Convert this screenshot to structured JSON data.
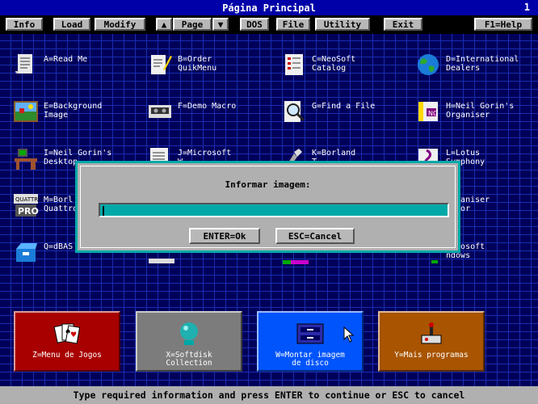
{
  "title": "Página Principal",
  "page_number": "1",
  "menu": {
    "info": "Info",
    "load": "Load",
    "modify": "Modify",
    "page": "Page",
    "dos": "DOS",
    "file": "File",
    "utility": "Utility",
    "exit": "Exit",
    "help": "F1=Help"
  },
  "items": [
    {
      "label": "A=Read Me",
      "icon": "document-icon"
    },
    {
      "label": "B=Order\nQuikMenu",
      "icon": "order-form-icon"
    },
    {
      "label": "C=NeoSoft\nCatalog",
      "icon": "catalog-icon"
    },
    {
      "label": "D=International\nDealers",
      "icon": "globe-icon"
    },
    {
      "label": "E=Background\nImage",
      "icon": "landscape-picture-icon"
    },
    {
      "label": "F=Demo Macro",
      "icon": "cassette-icon"
    },
    {
      "label": "G=Find a File",
      "icon": "magnifier-icon"
    },
    {
      "label": "H=Neil Gorin's\nOrganiser",
      "icon": "organiser-icon"
    },
    {
      "label": "I=Neil Gorin's\nDesktop",
      "icon": "desk-icon"
    },
    {
      "label": "J=Microsoft\nW",
      "icon": "word-icon"
    },
    {
      "label": "K=Borland\nT",
      "icon": "borland-tools-icon"
    },
    {
      "label": "L=Lotus\nSymphony",
      "icon": "lotus-symphony-icon"
    },
    {
      "label": "M=Borl\nQuattro",
      "icon": "quattro-pro-icon"
    },
    {
      "label": "",
      "icon": "blank-icon"
    },
    {
      "label": "",
      "icon": "blank-icon"
    },
    {
      "label": "Organiser\nlator",
      "icon": "organiser-calc-icon"
    },
    {
      "label": "Q=dBAS",
      "icon": "dbase-box-icon"
    },
    {
      "label": "",
      "icon": "blank-icon"
    },
    {
      "label": "",
      "icon": "blank-icon"
    },
    {
      "label": "icrosoft\nndows",
      "icon": "windows-icon"
    }
  ],
  "dialog": {
    "title": "Informar imagem:",
    "input_value": "",
    "ok": "ENTER=Ok",
    "cancel": "ESC=Cancel"
  },
  "big_buttons": [
    {
      "label": "Z=Menu de Jogos",
      "icon": "playing-cards-icon",
      "color": "#a80000"
    },
    {
      "label": "X=Softdisk\nCollection",
      "icon": "crystal-ball-icon",
      "color": "#7c7c7c"
    },
    {
      "label": "W=Montar imagem\nde disco",
      "icon": "disk-drive-icon",
      "color": "#0054fc"
    },
    {
      "label": "Y=Mais programas",
      "icon": "joystick-icon",
      "color": "#a85400"
    }
  ],
  "status": "Type required information and press ENTER to continue or ESC to cancel"
}
